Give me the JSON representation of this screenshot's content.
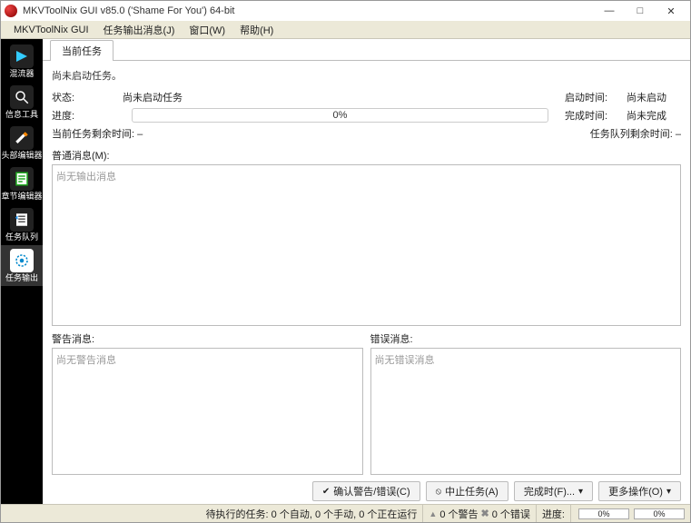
{
  "window": {
    "title": "MKVToolNix GUI v85.0 ('Shame For You') 64-bit",
    "min": "—",
    "max": "□",
    "close": "✕"
  },
  "menu": {
    "m1": "MKVToolNix GUI",
    "m2": "任务输出消息(J)",
    "m3": "窗口(W)",
    "m4": "帮助(H)"
  },
  "sidebar": {
    "s1": "混流器",
    "s2": "信息工具",
    "s3": "头部编辑器",
    "s4": "章节编辑器",
    "s5": "任务队列",
    "s6": "任务输出"
  },
  "tab": {
    "current": "当前任务"
  },
  "info": {
    "not_started": "尚未启动任务。",
    "status_lab": "状态:",
    "status_val": "尚未启动任务",
    "start_lab": "启动时间:",
    "start_val": "尚未启动",
    "progress_lab": "进度:",
    "progress_val": "0%",
    "finish_lab": "完成时间:",
    "finish_val": "尚未完成",
    "cur_remain_lab": "当前任务剩余时间:",
    "cur_remain_val": "–",
    "queue_remain_lab": "任务队列剩余时间:",
    "queue_remain_val": "–",
    "normal_msg_lab": "普通消息(M):",
    "normal_msg_placeholder": "尚无输出消息",
    "warn_lab": "警告消息:",
    "warn_placeholder": "尚无警告消息",
    "err_lab": "错误消息:",
    "err_placeholder": "尚无错误消息"
  },
  "buttons": {
    "ack": "确认警告/错误(C)",
    "abort": "中止任务(A)",
    "after": "完成时(F)...",
    "more": "更多操作(O)"
  },
  "status": {
    "pending": "待执行的任务: 0 个自动, 0 个手动, 0 个正在运行",
    "warn": "0 个警告",
    "err": "0 个错误",
    "prog_lab": "进度:",
    "p1": "0%",
    "p2": "0%"
  }
}
